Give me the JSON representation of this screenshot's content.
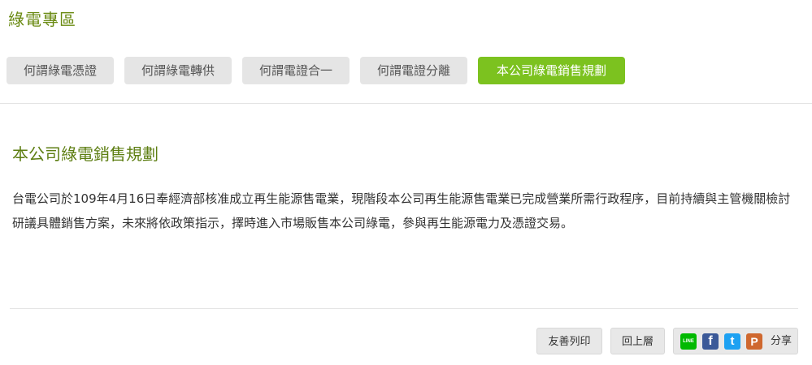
{
  "header": {
    "title": "綠電專區"
  },
  "tabs": [
    {
      "label": "何謂綠電憑證",
      "active": false
    },
    {
      "label": "何謂綠電轉供",
      "active": false
    },
    {
      "label": "何謂電證合一",
      "active": false
    },
    {
      "label": "何謂電證分離",
      "active": false
    },
    {
      "label": "本公司綠電銷售規劃",
      "active": true
    }
  ],
  "content": {
    "title": "本公司綠電銷售規劃",
    "paragraph": "台電公司於109年4月16日奉經濟部核准成立再生能源售電業，現階段本公司再生能源售電業已完成營業所需行政程序，目前持續與主管機關檢討研議具體銷售方案，未來將依政策指示，擇時進入市場販售本公司綠電，參與再生能源電力及憑證交易。"
  },
  "toolbar": {
    "print_label": "友善列印",
    "back_label": "回上層",
    "share_label": "分享",
    "share_icons": [
      {
        "name": "line-icon",
        "glyph": "LINE",
        "color": "#00b900"
      },
      {
        "name": "facebook-icon",
        "glyph": "f",
        "color": "#3b5998"
      },
      {
        "name": "twitter-icon",
        "glyph": "t",
        "color": "#1da1f2"
      },
      {
        "name": "plurk-icon",
        "glyph": "P",
        "color": "#cf682f"
      }
    ]
  },
  "colors": {
    "accent": "#7cc21f",
    "heading": "#6a8a12",
    "tab_inactive": "#e5e5e5"
  }
}
